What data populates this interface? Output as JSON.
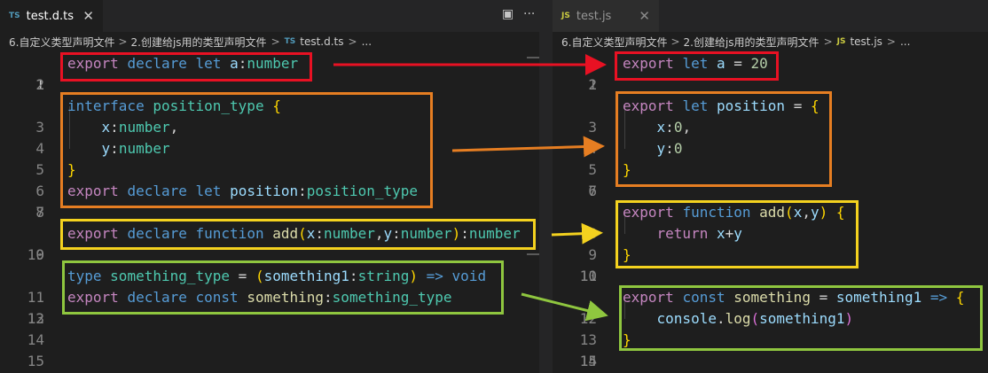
{
  "left": {
    "tab_label": "test.d.ts",
    "tab_icon": "TS",
    "breadcrumbs": [
      "6.自定义类型声明文件",
      "2.创建给js用的类型声明文件",
      "test.d.ts",
      "..."
    ],
    "breadcrumb_icon": "TS",
    "line_numbers": [
      "1",
      "2",
      "3",
      "4",
      "5",
      "6",
      "7",
      "8",
      "9",
      "10",
      "11",
      "12",
      "13",
      "14",
      "15"
    ]
  },
  "right": {
    "tab_label": "test.js",
    "tab_icon": "JS",
    "breadcrumbs": [
      "6.自定义类型声明文件",
      "2.创建给js用的类型声明文件",
      "test.js",
      "..."
    ],
    "breadcrumb_icon": "JS",
    "line_numbers": [
      "1",
      "2",
      "3",
      "4",
      "5",
      "6",
      "7",
      "8",
      "9",
      "10",
      "11",
      "12",
      "13",
      "14",
      "15"
    ]
  },
  "glyphs": {
    "close": "✕",
    "sep": ">",
    "split": "▣",
    "more": "···"
  },
  "code_left": {
    "l1": [
      "export",
      "declare",
      "let",
      "a",
      ":",
      "number"
    ],
    "l3": [
      "interface",
      "position_type",
      "{"
    ],
    "l4": [
      "x",
      ":",
      "number",
      ","
    ],
    "l5": [
      "y",
      ":",
      "number"
    ],
    "l6": [
      "}"
    ],
    "l7": [
      "export",
      "declare",
      "let",
      "position",
      ":",
      "position_type"
    ],
    "l9": [
      "export",
      "declare",
      "function",
      "add",
      "(",
      "x",
      ":",
      "number",
      ",",
      "y",
      ":",
      "number",
      ")",
      ":",
      "number"
    ],
    "l11": [
      "type",
      "something_type",
      "=",
      "(",
      "something1",
      ":",
      "string",
      ")",
      "=>",
      "void"
    ],
    "l12": [
      "export",
      "declare",
      "const",
      "something",
      ":",
      "something_type"
    ]
  },
  "code_right": {
    "l1": [
      "export",
      "let",
      "a",
      "=",
      "20"
    ],
    "l3": [
      "export",
      "let",
      "position",
      "=",
      "{"
    ],
    "l4": [
      "x",
      ":",
      "0",
      ","
    ],
    "l5": [
      "y",
      ":",
      "0"
    ],
    "l6": [
      "}"
    ],
    "l8": [
      "export",
      "function",
      "add",
      "(",
      "x",
      ",",
      "y",
      ")",
      "{"
    ],
    "l9": [
      "return",
      "x",
      "+",
      "y"
    ],
    "l10": [
      "}"
    ],
    "l12": [
      "export",
      "const",
      "something",
      "=",
      "something1",
      "=>",
      "{"
    ],
    "l13": [
      "console",
      ".",
      "log",
      "(",
      "something1",
      ")"
    ],
    "l14": [
      "}"
    ]
  },
  "annotation_colors": {
    "red": "#e81123",
    "orange": "#e67e22",
    "yellow": "#f4d21f",
    "green": "#8fc63f"
  }
}
